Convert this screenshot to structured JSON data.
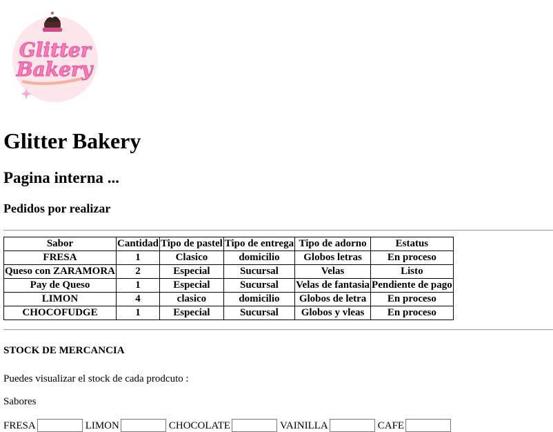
{
  "logo": {
    "line1": "Glitter",
    "line2": "Bakery"
  },
  "header": {
    "title": "Glitter Bakery",
    "subtitle": "Pagina interna ...",
    "orders_heading": "Pedidos por realizar"
  },
  "orders_table": {
    "headers": [
      "Sabor",
      "Cantidad",
      "Tipo de pastel",
      "Tipo de entrega",
      "Tipo de adorno",
      "Estatus"
    ],
    "rows": [
      [
        "FRESA",
        "1",
        "Clasico",
        "domicilio",
        "Globos letras",
        "En proceso"
      ],
      [
        "Queso con ZARAMORA",
        "2",
        "Especial",
        "Sucursal",
        "Velas",
        "Listo"
      ],
      [
        "Pay de Queso",
        "1",
        "Especial",
        "Sucursal",
        "Velas de fantasia",
        "Pendiente de pago"
      ],
      [
        "LIMON",
        "4",
        "clasico",
        "domicilio",
        "Globos de letra",
        "En proceso"
      ],
      [
        "CHOCOFUDGE",
        "1",
        "Especial",
        "Sucursal",
        "Globos y vleas",
        "En proceso"
      ]
    ]
  },
  "stock": {
    "heading": "STOCK DE MERCANCIA",
    "description": "Puedes visualizar el stock de cada prodcuto :",
    "flavors_label": "Sabores",
    "flavors": [
      {
        "label": "FRESA",
        "value": ""
      },
      {
        "label": "LIMON",
        "value": ""
      },
      {
        "label": "CHOCOLATE",
        "value": ""
      },
      {
        "label": "VAINILLA",
        "value": ""
      },
      {
        "label": "CAFE",
        "value": ""
      }
    ]
  },
  "colors": {
    "logo_bg": "#fde6ea",
    "logo_pink": "#f06aa8",
    "logo_text_pink": "#ff79b8"
  }
}
